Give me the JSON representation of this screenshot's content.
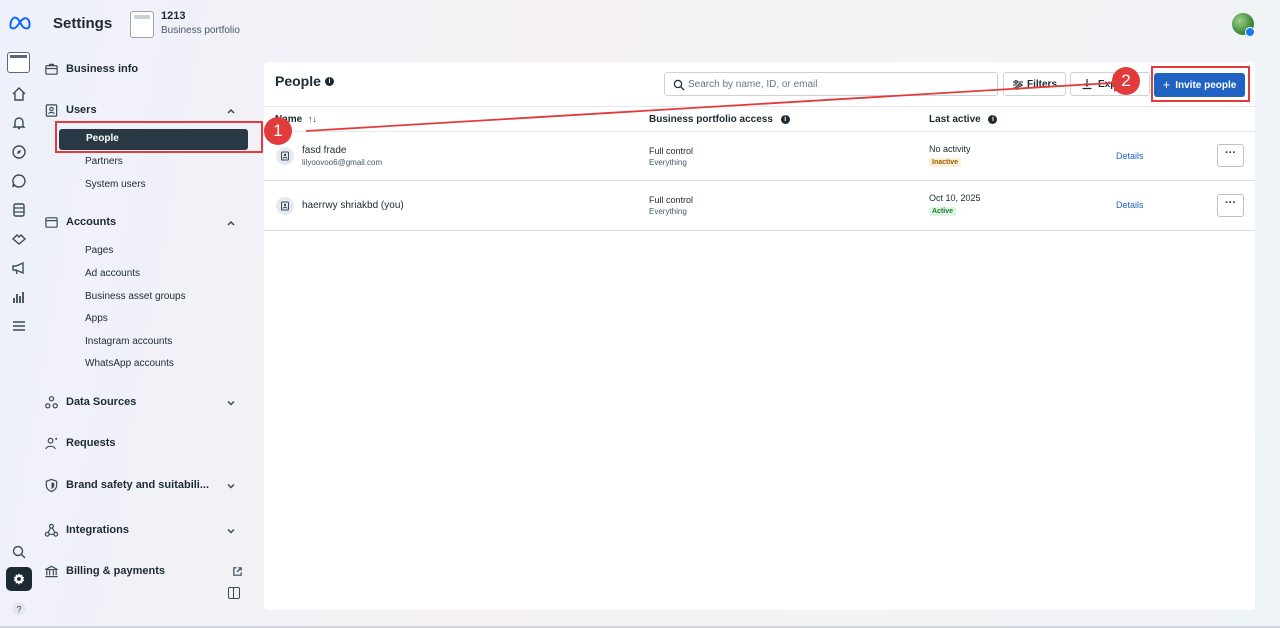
{
  "header": {
    "title": "Settings",
    "portfolio_name": "1213",
    "portfolio_sub": "Business portfolio"
  },
  "sidebar": {
    "business_info": "Business info",
    "users": {
      "label": "Users",
      "items": [
        "People",
        "Partners",
        "System users"
      ]
    },
    "accounts": {
      "label": "Accounts",
      "items": [
        "Pages",
        "Ad accounts",
        "Business asset groups",
        "Apps",
        "Instagram accounts",
        "WhatsApp accounts"
      ]
    },
    "data_sources": "Data Sources",
    "requests": "Requests",
    "brand_safety": "Brand safety and suitabili...",
    "integrations": "Integrations",
    "billing": "Billing & payments"
  },
  "panel": {
    "title": "People",
    "search_placeholder": "Search by name, ID, or email",
    "filters_label": "Filters",
    "export_label": "Exp",
    "invite_label": "Invite people",
    "columns": [
      "Name",
      "Business portfolio access",
      "Last active"
    ],
    "rows": [
      {
        "name": "fasd frade",
        "email": "lilyoovoo6@gmail.com",
        "access": "Full control",
        "access_sub": "Everything",
        "last_active": "No activity",
        "status": "Inactive",
        "details": "Details"
      },
      {
        "name": "haerrwy shriakbd (you)",
        "email": "",
        "access": "Full control",
        "access_sub": "Everything",
        "last_active": "Oct 10, 2025",
        "status": "Active",
        "details": "Details"
      }
    ]
  },
  "annotations": {
    "step1": "1",
    "step2": "2",
    "color": "#e23b3b"
  },
  "colors": {
    "primary": "#1f62c2",
    "selected_nav": "#283845"
  }
}
